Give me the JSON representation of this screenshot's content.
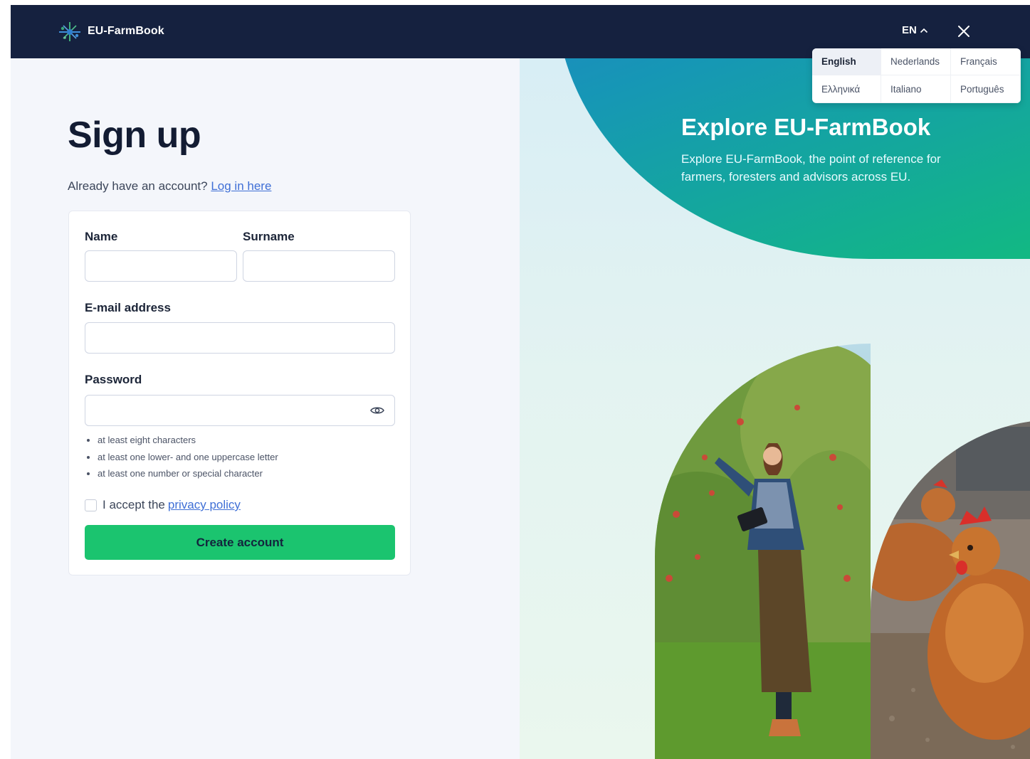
{
  "header": {
    "brand": "EU-FarmBook",
    "language_code": "EN"
  },
  "languages": [
    "English",
    "Nederlands",
    "Français",
    "Ελληνικά",
    "Italiano",
    "Português"
  ],
  "selected_language": "English",
  "signup": {
    "title": "Sign up",
    "have_account": "Already have an account?",
    "login_link": "Log in here",
    "name_label": "Name",
    "surname_label": "Surname",
    "email_label": "E-mail address",
    "password_label": "Password",
    "password_rules": [
      "at least eight characters",
      "at least one lower- and one uppercase letter",
      "at least one number or special character"
    ],
    "accept_text": "I accept the",
    "privacy_link": "privacy policy",
    "create_button": "Create account"
  },
  "promo": {
    "title": "Explore EU-FarmBook",
    "text": "Explore EU-FarmBook, the point of reference for farmers, foresters and advisors across EU."
  },
  "colors": {
    "header_bg": "#15213f",
    "button_green": "#1bc46f",
    "link_blue": "#3f6fd6",
    "gradient_blue": "#2a6fd4",
    "gradient_green": "#11bf79"
  }
}
